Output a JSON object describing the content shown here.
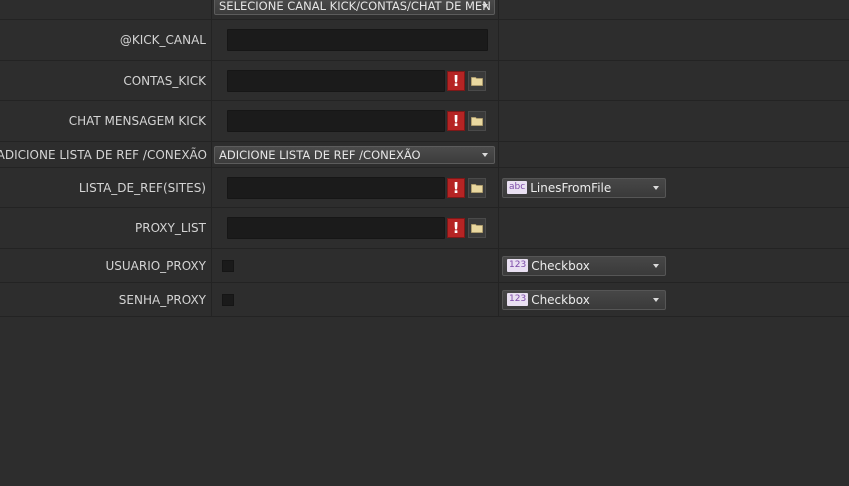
{
  "rows": {
    "canal_select": {
      "value": "SELECIONE CANAL KICK/CONTAS/CHAT DE MEN"
    },
    "kick_canal": {
      "label": "@KICK_CANAL"
    },
    "contas_kick": {
      "label": "CONTAS_KICK",
      "warning": "!"
    },
    "chat_mensagem": {
      "label": "CHAT MENSAGEM KICK",
      "warning": "!"
    },
    "adicione_lista": {
      "label": "ADICIONE LISTA DE REF /CONEXÃO",
      "value": "ADICIONE LISTA DE REF /CONEXÃO"
    },
    "lista_ref": {
      "label": "LISTA_DE_REF(SITES)",
      "warning": "!",
      "type_badge": "abc",
      "type_value": "LinesFromFile"
    },
    "proxy_list": {
      "label": "PROXY_LIST",
      "warning": "!"
    },
    "usuario_proxy": {
      "label": "USUARIO_PROXY",
      "type_badge": "123",
      "type_value": "Checkbox"
    },
    "senha_proxy": {
      "label": "SENHA_PROXY",
      "type_badge": "123",
      "type_value": "Checkbox"
    }
  },
  "icons": {
    "warning": "warning-icon",
    "folder": "folder-icon",
    "dropdown": "chevron-down-icon"
  },
  "colors": {
    "background": "#2d2d2d",
    "field": "#1b1b1b",
    "warning": "#b52424",
    "badge_text": "#7c4aa8"
  }
}
